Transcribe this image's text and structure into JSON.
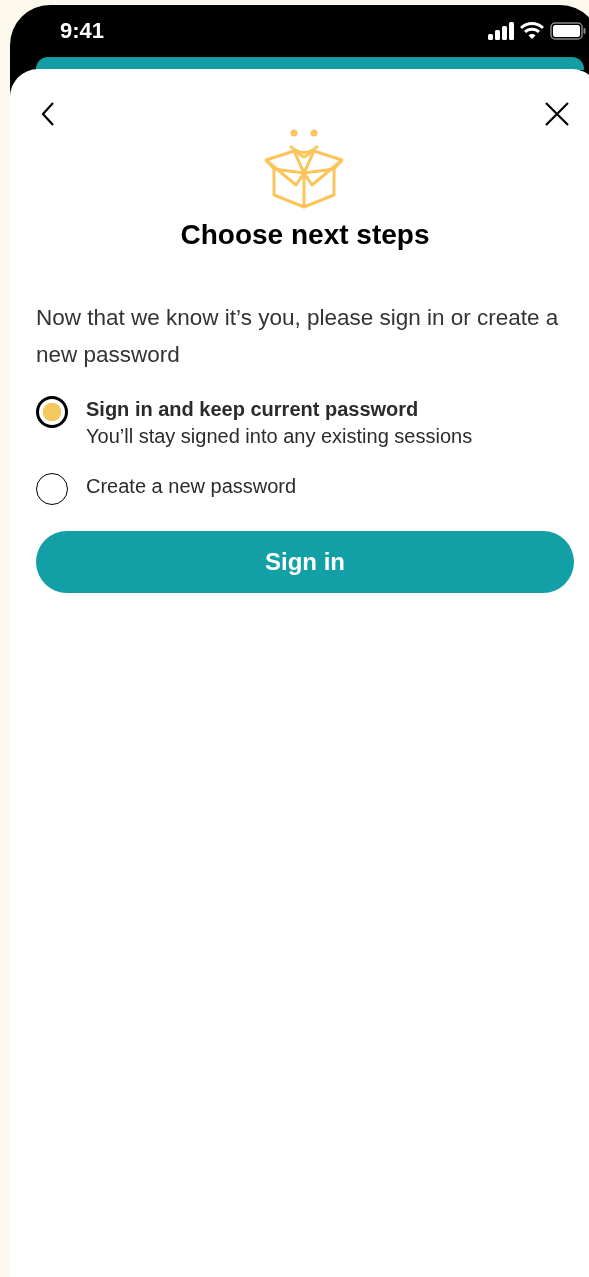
{
  "status_bar": {
    "time": "9:41"
  },
  "title": "Choose next steps",
  "intro": "Now that we know it’s you, please sign in or create a new password",
  "options": [
    {
      "label": "Sign in and keep current password",
      "description": "You’ll stay signed into any existing sessions",
      "selected": true
    },
    {
      "label": "Create a new password",
      "selected": false
    }
  ],
  "primary_button": "Sign in"
}
